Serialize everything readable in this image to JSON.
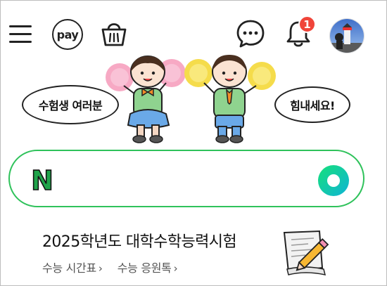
{
  "topbar": {
    "menu_icon": "hamburger-icon",
    "pay_label": "pay",
    "shopping_icon": "shopping-bag-icon",
    "chat_icon": "chat-bubble-icon",
    "notification_icon": "bell-icon",
    "notification_count": "1",
    "avatar_icon": "profile-avatar"
  },
  "banner": {
    "left_bubble": "수험생 여러분",
    "right_bubble": "힘내세요!"
  },
  "search": {
    "logo": "N",
    "value": "",
    "lens_icon": "green-search-icon"
  },
  "csat": {
    "title": "2025학년도 대학수학능력시험",
    "links": [
      "수능 시간표",
      "수능 응원톡"
    ],
    "chevron": "›"
  },
  "colors": {
    "brand_green": "#2fc25b",
    "badge_red": "#f0453a"
  }
}
